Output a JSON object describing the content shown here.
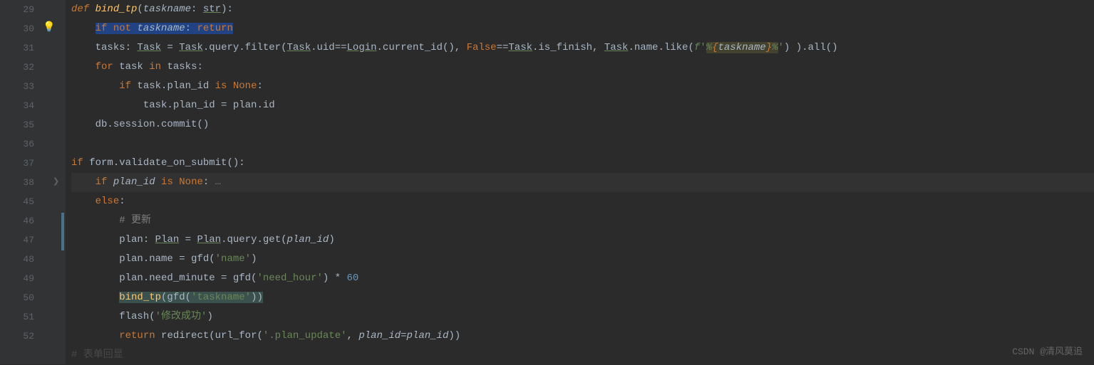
{
  "watermark": "CSDN @清风莫追",
  "lines": [
    {
      "n": "29",
      "html": "<span class='kw-i'>def </span><span class='fn-i'>bind_tp</span><span class='op'>(</span><span class='param'>taskname</span><span class='op'>: </span><span class='cls'>str</span><span class='op'>):</span>"
    },
    {
      "n": "30",
      "html": "    <span class='sel'><span class='kw'>if</span> <span class='kw'>not</span> <span class='param'>taskname</span><span class='op'>:</span> <span class='kw'>return</span></span>"
    },
    {
      "n": "31",
      "html": "    <span class='op'>tasks: </span><span class='cls'>Task</span><span class='op'> = </span><span class='cls'>Task</span><span class='op'>.query.filter(</span><span class='cls'>Task</span><span class='op'>.uid==</span><span class='cls'>Login</span><span class='op'>.current_id(), </span><span class='kw'>False</span><span class='op'>==</span><span class='cls'>Task</span><span class='op'>.is_finish, </span><span class='cls'>Task</span><span class='op'>.name.like(</span><span class='fstr'>f</span><span class='str'>'</span><span class='param-hl'><span class='str'>%</span><span class='kw'>{</span><span class='param'>taskname</span><span class='kw'>}</span><span class='str'>%</span></span><span class='str'>'</span><span class='op'>) ).all()</span>"
    },
    {
      "n": "32",
      "html": "    <span class='kw'>for</span><span class='op'> task </span><span class='kw'>in</span><span class='op'> tasks:</span>"
    },
    {
      "n": "33",
      "html": "        <span class='kw'>if</span><span class='op'> task.plan_id </span><span class='kw'>is</span><span class='op'> </span><span class='kw'>None</span><span class='op'>:</span>"
    },
    {
      "n": "34",
      "html": "            <span class='op'>task.plan_id = plan.id</span>"
    },
    {
      "n": "35",
      "html": "    <span class='op'>db.session.commit()</span>"
    },
    {
      "n": "36",
      "html": ""
    },
    {
      "n": "37",
      "html": "<span class='kw'>if</span><span class='op'> form.validate_on_submit():</span>"
    },
    {
      "n": "38",
      "html": "    <span class='kw'>if</span><span class='op'> </span><span class='param'>plan_id</span><span class='op'> </span><span class='kw'>is</span><span class='op'> </span><span class='kw'>None</span><span class='op'>:</span><span class='fold-dots'> &#8230;</span>",
      "current": true
    },
    {
      "n": "45",
      "html": "    <span class='kw'>else</span><span class='op'>:</span>"
    },
    {
      "n": "46",
      "html": "        <span class='cmt'># 更新</span>"
    },
    {
      "n": "47",
      "html": "        <span class='op'>plan: </span><span class='cls'>Plan</span><span class='op'> = </span><span class='cls'>Plan</span><span class='op'>.query.get(</span><span class='param'>plan_id</span><span class='op'>)</span>"
    },
    {
      "n": "48",
      "html": "        <span class='op'>plan.name = gfd(</span><span class='str'>'name'</span><span class='op'>)</span>"
    },
    {
      "n": "49",
      "html": "        <span class='op'>plan.need_minute = gfd(</span><span class='str'>'need_hour'</span><span class='op'>) * </span><span class='num'>60</span>"
    },
    {
      "n": "50",
      "html": "        <span class='sel2'><span class='fn'>bind_tp</span><span class='op'>(gfd(</span><span class='str'>'taskname'</span><span class='op'>))</span></span>"
    },
    {
      "n": "51",
      "html": "        <span class='op'>flash(</span><span class='str'>'修改成功'</span><span class='op'>)</span>"
    },
    {
      "n": "52",
      "html": "        <span class='kw'>return</span><span class='op'> redirect(url_for(</span><span class='str'>'.plan_update'</span><span class='op'>, </span><span class='param'>plan_id</span><span class='op'>=</span><span class='param'>plan_id</span><span class='op'>))</span>"
    },
    {
      "n": "",
      "html": "<span class='cmt'># 表单回显</span>",
      "dim": true
    }
  ]
}
